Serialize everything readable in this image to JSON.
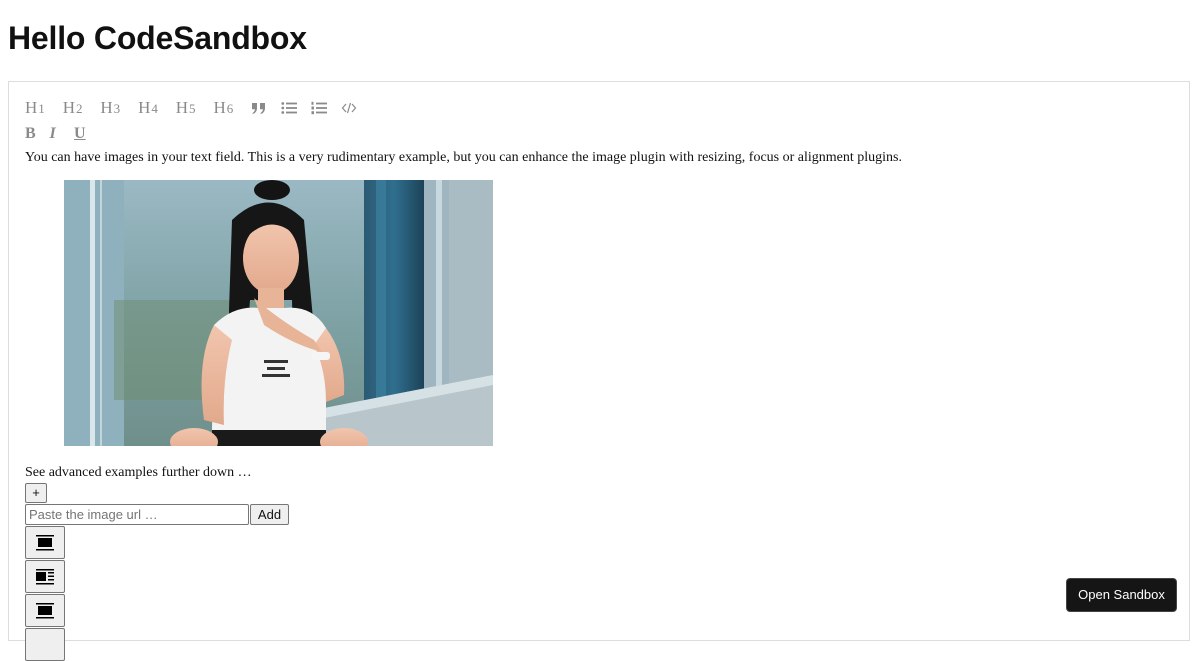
{
  "page": {
    "title": "Hello CodeSandbox"
  },
  "toolbar": {
    "headings": [
      {
        "letter": "H",
        "num": "1"
      },
      {
        "letter": "H",
        "num": "2"
      },
      {
        "letter": "H",
        "num": "3"
      },
      {
        "letter": "H",
        "num": "4"
      },
      {
        "letter": "H",
        "num": "5"
      },
      {
        "letter": "H",
        "num": "6"
      }
    ],
    "block_icons": [
      "blockquote-icon",
      "unordered-list-icon",
      "ordered-list-icon",
      "code-block-icon"
    ],
    "bold_label": "B",
    "italic_label": "I",
    "underline_label": "U"
  },
  "editor": {
    "intro_text": "You can have images in your text field. This is a very rudimentary example, but you can enhance the image plugin with resizing, focus or alignment plugins.",
    "image_icon": "photo-of-woman",
    "footer_text": "See advanced examples further down …"
  },
  "image_controls": {
    "plus_label": "+",
    "url_placeholder": "Paste the image url …",
    "add_label": "Add",
    "align_icons": [
      "align-center-icon",
      "align-left-icon",
      "align-center-icon"
    ]
  },
  "sandbox": {
    "open_label": "Open Sandbox"
  }
}
